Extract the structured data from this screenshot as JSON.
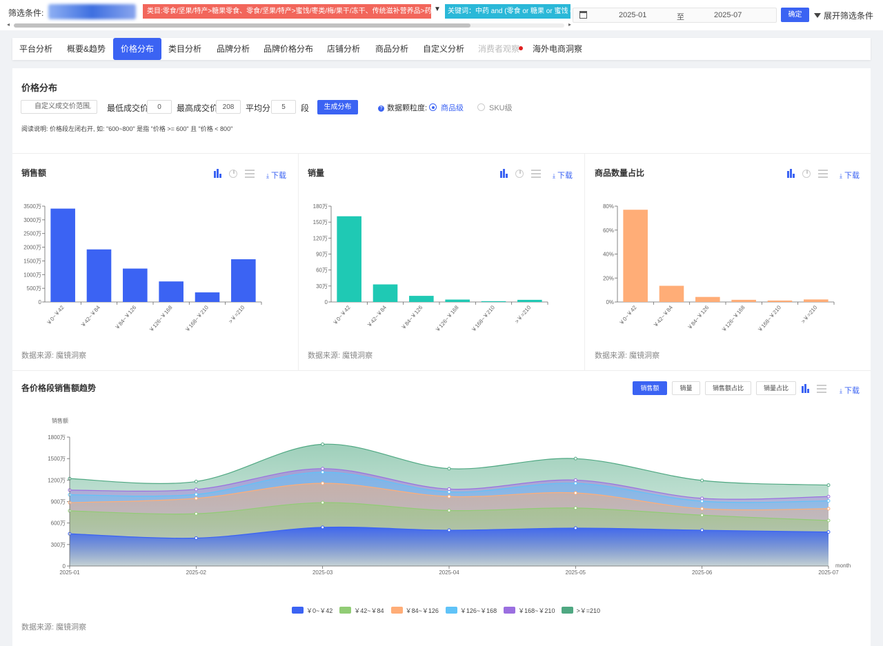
{
  "filter_bar": {
    "label": "筛选条件:",
    "category_tag": "类目:零食/坚果/特产>糖果零食、零食/坚果/特产>蜜饯/枣类/梅/果干/冻干、传统滋补营养品>药食同源食品",
    "keyword_tag": "关键词：中药 and (零食 or 糖果 or 蜜饯 or 枣",
    "date_start": "2025-01",
    "date_sep": "至",
    "date_end": "2025-07",
    "confirm_label": "确定",
    "expand_label": "展开筛选条件"
  },
  "tabs": [
    {
      "label": "平台分析",
      "state": "normal"
    },
    {
      "label": "概要&趋势",
      "state": "normal"
    },
    {
      "label": "价格分布",
      "state": "active"
    },
    {
      "label": "类目分析",
      "state": "normal"
    },
    {
      "label": "品牌分析",
      "state": "normal"
    },
    {
      "label": "品牌价格分布",
      "state": "normal"
    },
    {
      "label": "店铺分析",
      "state": "normal"
    },
    {
      "label": "商品分析",
      "state": "normal"
    },
    {
      "label": "自定义分析",
      "state": "normal"
    },
    {
      "label": "消费者观察",
      "state": "disabled"
    },
    {
      "label": "海外电商洞察",
      "state": "normal"
    }
  ],
  "price_dist": {
    "title": "价格分布",
    "range_select": "自定义成交价范围",
    "min_label": "最低成交价",
    "min_value": "0",
    "max_label": "最高成交价",
    "max_value": "208",
    "avg_label": "平均分",
    "avg_value": "5",
    "seg_label": "段",
    "generate_label": "生成分布",
    "granularity_label": "数据颗粒度:",
    "option_product": "商品级",
    "option_sku": "SKU级",
    "note": "阅读说明: 价格段左闭右开, 如: \"600~800\" 是指 \"价格 >= 600\" 且 \"价格 < 800\""
  },
  "common": {
    "download": "下载",
    "source": "数据来源: 魔镜洞察"
  },
  "chart_data": [
    {
      "type": "bar",
      "title": "销售额",
      "categories": [
        "￥0~￥42",
        "￥42~￥84",
        "￥84~￥126",
        "￥126~￥168",
        "￥168~￥210",
        ">￥=210"
      ],
      "values": [
        3410,
        1920,
        1220,
        750,
        350,
        1560
      ],
      "ylim": [
        0,
        3500
      ],
      "yticks": [
        "0",
        "500万",
        "1000万",
        "1500万",
        "2000万",
        "2500万",
        "3000万",
        "3500万"
      ],
      "color": "#3b63f3"
    },
    {
      "type": "bar",
      "title": "销量",
      "categories": [
        "￥0~￥42",
        "￥42~￥84",
        "￥84~￥126",
        "￥126~￥168",
        "￥168~￥210",
        ">￥=210"
      ],
      "values": [
        161,
        33,
        11.5,
        4.5,
        1.5,
        4
      ],
      "ylim": [
        0,
        180
      ],
      "yticks": [
        "0",
        "30万",
        "60万",
        "90万",
        "120万",
        "150万",
        "180万"
      ],
      "color": "#1fc9b4"
    },
    {
      "type": "bar",
      "title": "商品数量占比",
      "categories": [
        "￥0~￥42",
        "￥42~￥84",
        "￥84~￥126",
        "￥126~￥168",
        "￥168~￥210",
        ">￥=210"
      ],
      "values": [
        77,
        13.5,
        4.2,
        1.8,
        1.2,
        2.1
      ],
      "ylim": [
        0,
        80
      ],
      "yticks": [
        "0%",
        "20%",
        "40%",
        "60%",
        "80%"
      ],
      "color": "#ffad77"
    },
    {
      "type": "area",
      "title": "各价格段销售额趋势",
      "ylabel": "销售额",
      "xlabel": "month",
      "x": [
        "2025-01",
        "2025-02",
        "2025-03",
        "2025-04",
        "2025-05",
        "2025-06",
        "2025-07"
      ],
      "ylim": [
        0,
        1800
      ],
      "yticks": [
        "0",
        "300万",
        "600万",
        "900万",
        "1200万",
        "1500万",
        "1800万"
      ],
      "stacked": true,
      "series": [
        {
          "name": "￥0~￥42",
          "values": [
            450,
            390,
            540,
            500,
            530,
            500,
            475
          ],
          "color": "#3b63f3"
        },
        {
          "name": "￥42~￥84",
          "values": [
            320,
            340,
            345,
            275,
            280,
            210,
            160
          ],
          "color": "#91cc75"
        },
        {
          "name": "￥84~￥126",
          "values": [
            115,
            215,
            270,
            195,
            210,
            90,
            165
          ],
          "color": "#ffad77"
        },
        {
          "name": "￥126~￥168",
          "values": [
            110,
            55,
            155,
            65,
            135,
            105,
            110
          ],
          "color": "#60c3f8"
        },
        {
          "name": "￥168~￥210",
          "values": [
            65,
            70,
            50,
            40,
            45,
            40,
            60
          ],
          "color": "#9b6fe0"
        },
        {
          "name": ">￥=210",
          "values": [
            160,
            110,
            340,
            285,
            300,
            250,
            160
          ],
          "color": "#4fa882"
        }
      ],
      "metric_buttons": [
        "销售额",
        "销量",
        "销售额占比",
        "销量占比"
      ],
      "active_metric": "销售额"
    }
  ]
}
